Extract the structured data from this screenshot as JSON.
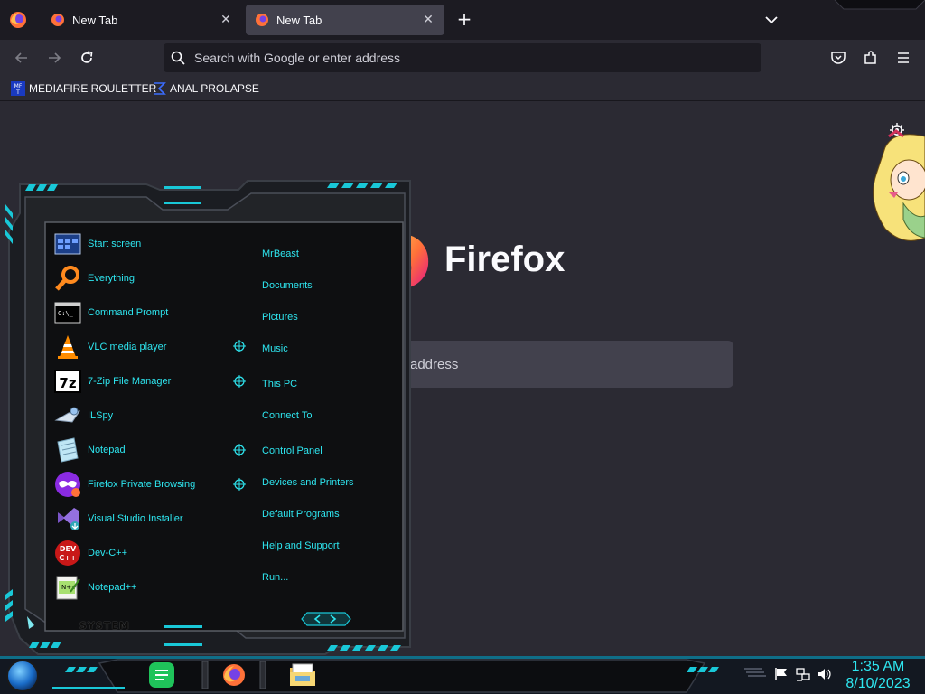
{
  "browser": {
    "tabs": [
      {
        "label": "New Tab",
        "active": false
      },
      {
        "label": "New Tab",
        "active": true
      }
    ],
    "url_placeholder": "Search with Google or enter address",
    "bookmarks": [
      {
        "label": "MEDIAFIRE ROULETTER",
        "icon": "mediafire-icon"
      },
      {
        "label": "ANAL PROLAPSE",
        "icon": "sigma-icon"
      }
    ],
    "newtab": {
      "brand": "Firefox",
      "search_placeholder_visible": "address"
    }
  },
  "start_menu": {
    "left_items": [
      {
        "label": "Start screen",
        "icon": "start-screen-icon"
      },
      {
        "label": "Everything",
        "icon": "magnifier-icon"
      },
      {
        "label": "Command Prompt",
        "icon": "cmd-icon"
      },
      {
        "label": "VLC media player",
        "icon": "vlc-cone-icon"
      },
      {
        "label": "7-Zip File Manager",
        "icon": "7zip-icon"
      },
      {
        "label": "ILSpy",
        "icon": "ilspy-icon"
      },
      {
        "label": "Notepad",
        "icon": "notepad-icon"
      },
      {
        "label": "Firefox Private Browsing",
        "icon": "private-browsing-icon"
      },
      {
        "label": "Visual Studio Installer",
        "icon": "vs-installer-icon"
      },
      {
        "label": "Dev-C++",
        "icon": "devcpp-icon"
      },
      {
        "label": "Notepad++",
        "icon": "notepadpp-icon"
      }
    ],
    "right_items": [
      {
        "label": "MrBeast",
        "arrow": false
      },
      {
        "label": "Documents",
        "arrow": false
      },
      {
        "label": "Pictures",
        "arrow": false
      },
      {
        "label": "Music",
        "arrow": true
      },
      {
        "label": "This PC",
        "arrow": true
      },
      {
        "label": "Connect To",
        "arrow": false
      },
      {
        "label": "Control Panel",
        "arrow": true
      },
      {
        "label": "Devices and Printers",
        "arrow": true
      },
      {
        "label": "Default Programs",
        "arrow": false
      },
      {
        "label": "Help and Support",
        "arrow": false
      },
      {
        "label": "Run...",
        "arrow": false
      }
    ],
    "footer_label": "SYSTEM"
  },
  "taskbar": {
    "apps": [
      "notes-app-icon",
      "firefox-icon",
      "file-explorer-icon"
    ],
    "clock_time": "1:35 AM",
    "clock_date": "8/10/2023"
  },
  "colors": {
    "accent_cyan": "#2ee6f0",
    "browser_bg": "#2b2a33",
    "tabstrip_bg": "#1c1b22"
  }
}
